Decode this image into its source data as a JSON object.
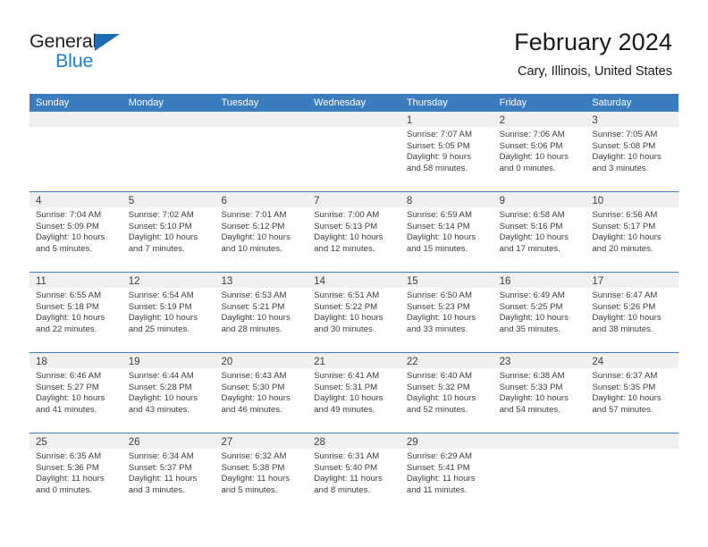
{
  "brand": {
    "name_top": "General",
    "name_bottom": "Blue",
    "triangle_color": "#1b6cb5",
    "blue_color": "#1b7fd4"
  },
  "header": {
    "title": "February 2024",
    "location": "Cary, Illinois, United States"
  },
  "theme": {
    "header_blue": "#3a7cbe",
    "day_band_gray": "#f0f0f0",
    "text_color": "#3d3d3d"
  },
  "weekday_headers": [
    "Sunday",
    "Monday",
    "Tuesday",
    "Wednesday",
    "Thursday",
    "Friday",
    "Saturday"
  ],
  "weeks": [
    [
      {
        "day": "",
        "sunrise": "",
        "sunset": "",
        "daylight1": "",
        "daylight2": ""
      },
      {
        "day": "",
        "sunrise": "",
        "sunset": "",
        "daylight1": "",
        "daylight2": ""
      },
      {
        "day": "",
        "sunrise": "",
        "sunset": "",
        "daylight1": "",
        "daylight2": ""
      },
      {
        "day": "",
        "sunrise": "",
        "sunset": "",
        "daylight1": "",
        "daylight2": ""
      },
      {
        "day": "1",
        "sunrise": "Sunrise: 7:07 AM",
        "sunset": "Sunset: 5:05 PM",
        "daylight1": "Daylight: 9 hours",
        "daylight2": "and 58 minutes."
      },
      {
        "day": "2",
        "sunrise": "Sunrise: 7:06 AM",
        "sunset": "Sunset: 5:06 PM",
        "daylight1": "Daylight: 10 hours",
        "daylight2": "and 0 minutes."
      },
      {
        "day": "3",
        "sunrise": "Sunrise: 7:05 AM",
        "sunset": "Sunset: 5:08 PM",
        "daylight1": "Daylight: 10 hours",
        "daylight2": "and 3 minutes."
      }
    ],
    [
      {
        "day": "4",
        "sunrise": "Sunrise: 7:04 AM",
        "sunset": "Sunset: 5:09 PM",
        "daylight1": "Daylight: 10 hours",
        "daylight2": "and 5 minutes."
      },
      {
        "day": "5",
        "sunrise": "Sunrise: 7:02 AM",
        "sunset": "Sunset: 5:10 PM",
        "daylight1": "Daylight: 10 hours",
        "daylight2": "and 7 minutes."
      },
      {
        "day": "6",
        "sunrise": "Sunrise: 7:01 AM",
        "sunset": "Sunset: 5:12 PM",
        "daylight1": "Daylight: 10 hours",
        "daylight2": "and 10 minutes."
      },
      {
        "day": "7",
        "sunrise": "Sunrise: 7:00 AM",
        "sunset": "Sunset: 5:13 PM",
        "daylight1": "Daylight: 10 hours",
        "daylight2": "and 12 minutes."
      },
      {
        "day": "8",
        "sunrise": "Sunrise: 6:59 AM",
        "sunset": "Sunset: 5:14 PM",
        "daylight1": "Daylight: 10 hours",
        "daylight2": "and 15 minutes."
      },
      {
        "day": "9",
        "sunrise": "Sunrise: 6:58 AM",
        "sunset": "Sunset: 5:16 PM",
        "daylight1": "Daylight: 10 hours",
        "daylight2": "and 17 minutes."
      },
      {
        "day": "10",
        "sunrise": "Sunrise: 6:56 AM",
        "sunset": "Sunset: 5:17 PM",
        "daylight1": "Daylight: 10 hours",
        "daylight2": "and 20 minutes."
      }
    ],
    [
      {
        "day": "11",
        "sunrise": "Sunrise: 6:55 AM",
        "sunset": "Sunset: 5:18 PM",
        "daylight1": "Daylight: 10 hours",
        "daylight2": "and 22 minutes."
      },
      {
        "day": "12",
        "sunrise": "Sunrise: 6:54 AM",
        "sunset": "Sunset: 5:19 PM",
        "daylight1": "Daylight: 10 hours",
        "daylight2": "and 25 minutes."
      },
      {
        "day": "13",
        "sunrise": "Sunrise: 6:53 AM",
        "sunset": "Sunset: 5:21 PM",
        "daylight1": "Daylight: 10 hours",
        "daylight2": "and 28 minutes."
      },
      {
        "day": "14",
        "sunrise": "Sunrise: 6:51 AM",
        "sunset": "Sunset: 5:22 PM",
        "daylight1": "Daylight: 10 hours",
        "daylight2": "and 30 minutes."
      },
      {
        "day": "15",
        "sunrise": "Sunrise: 6:50 AM",
        "sunset": "Sunset: 5:23 PM",
        "daylight1": "Daylight: 10 hours",
        "daylight2": "and 33 minutes."
      },
      {
        "day": "16",
        "sunrise": "Sunrise: 6:49 AM",
        "sunset": "Sunset: 5:25 PM",
        "daylight1": "Daylight: 10 hours",
        "daylight2": "and 35 minutes."
      },
      {
        "day": "17",
        "sunrise": "Sunrise: 6:47 AM",
        "sunset": "Sunset: 5:26 PM",
        "daylight1": "Daylight: 10 hours",
        "daylight2": "and 38 minutes."
      }
    ],
    [
      {
        "day": "18",
        "sunrise": "Sunrise: 6:46 AM",
        "sunset": "Sunset: 5:27 PM",
        "daylight1": "Daylight: 10 hours",
        "daylight2": "and 41 minutes."
      },
      {
        "day": "19",
        "sunrise": "Sunrise: 6:44 AM",
        "sunset": "Sunset: 5:28 PM",
        "daylight1": "Daylight: 10 hours",
        "daylight2": "and 43 minutes."
      },
      {
        "day": "20",
        "sunrise": "Sunrise: 6:43 AM",
        "sunset": "Sunset: 5:30 PM",
        "daylight1": "Daylight: 10 hours",
        "daylight2": "and 46 minutes."
      },
      {
        "day": "21",
        "sunrise": "Sunrise: 6:41 AM",
        "sunset": "Sunset: 5:31 PM",
        "daylight1": "Daylight: 10 hours",
        "daylight2": "and 49 minutes."
      },
      {
        "day": "22",
        "sunrise": "Sunrise: 6:40 AM",
        "sunset": "Sunset: 5:32 PM",
        "daylight1": "Daylight: 10 hours",
        "daylight2": "and 52 minutes."
      },
      {
        "day": "23",
        "sunrise": "Sunrise: 6:38 AM",
        "sunset": "Sunset: 5:33 PM",
        "daylight1": "Daylight: 10 hours",
        "daylight2": "and 54 minutes."
      },
      {
        "day": "24",
        "sunrise": "Sunrise: 6:37 AM",
        "sunset": "Sunset: 5:35 PM",
        "daylight1": "Daylight: 10 hours",
        "daylight2": "and 57 minutes."
      }
    ],
    [
      {
        "day": "25",
        "sunrise": "Sunrise: 6:35 AM",
        "sunset": "Sunset: 5:36 PM",
        "daylight1": "Daylight: 11 hours",
        "daylight2": "and 0 minutes."
      },
      {
        "day": "26",
        "sunrise": "Sunrise: 6:34 AM",
        "sunset": "Sunset: 5:37 PM",
        "daylight1": "Daylight: 11 hours",
        "daylight2": "and 3 minutes."
      },
      {
        "day": "27",
        "sunrise": "Sunrise: 6:32 AM",
        "sunset": "Sunset: 5:38 PM",
        "daylight1": "Daylight: 11 hours",
        "daylight2": "and 5 minutes."
      },
      {
        "day": "28",
        "sunrise": "Sunrise: 6:31 AM",
        "sunset": "Sunset: 5:40 PM",
        "daylight1": "Daylight: 11 hours",
        "daylight2": "and 8 minutes."
      },
      {
        "day": "29",
        "sunrise": "Sunrise: 6:29 AM",
        "sunset": "Sunset: 5:41 PM",
        "daylight1": "Daylight: 11 hours",
        "daylight2": "and 11 minutes."
      },
      {
        "day": "",
        "sunrise": "",
        "sunset": "",
        "daylight1": "",
        "daylight2": ""
      },
      {
        "day": "",
        "sunrise": "",
        "sunset": "",
        "daylight1": "",
        "daylight2": ""
      }
    ]
  ]
}
